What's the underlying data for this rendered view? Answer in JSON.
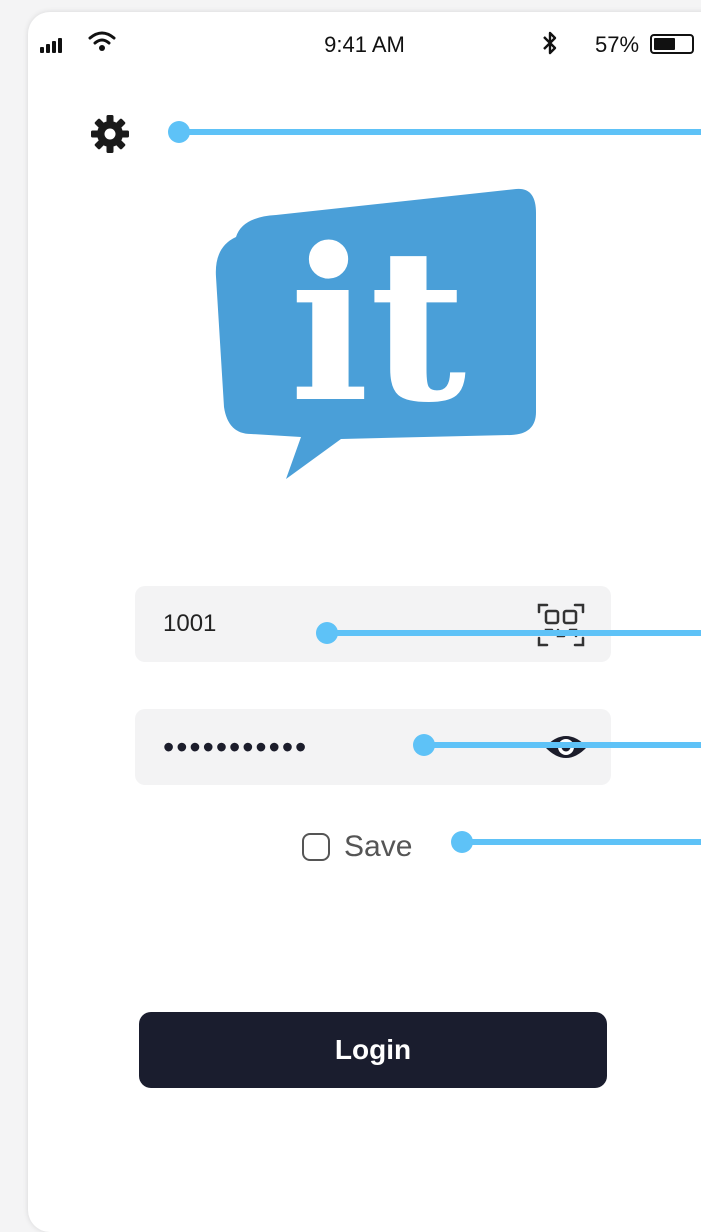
{
  "status_bar": {
    "time": "9:41 AM",
    "battery_pct": "57%",
    "battery_level": 0.57,
    "signal_bars": 4,
    "icons": [
      "signal-icon",
      "wifi-icon",
      "bluetooth-icon",
      "battery-icon"
    ]
  },
  "settings": {
    "icon": "gear-icon"
  },
  "logo": {
    "text": "it",
    "color": "#4a9fd8"
  },
  "form": {
    "username": {
      "value": "1001",
      "action_icon": "qr-scan-icon"
    },
    "password": {
      "value": "•••••••••••",
      "action_icon": "eye-icon"
    },
    "save": {
      "label": "Save",
      "checked": false
    }
  },
  "login_button": {
    "label": "Login"
  },
  "colors": {
    "accent": "#4a9fd8",
    "callout": "#5ec2f7",
    "button_bg": "#1a1d2e",
    "field_bg": "#f3f3f4"
  }
}
